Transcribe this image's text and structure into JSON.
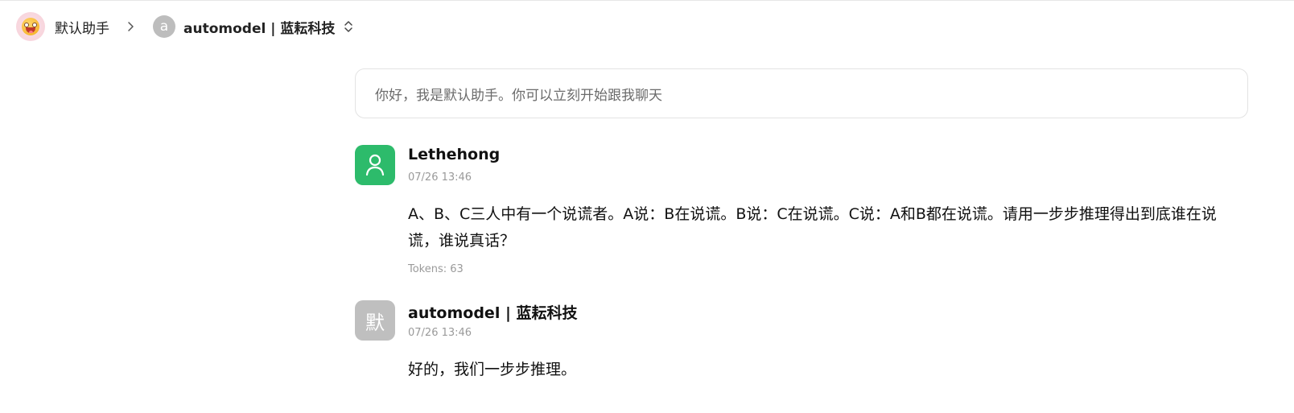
{
  "header": {
    "assistant_name": "默认助手",
    "model_initial": "a",
    "model_name": "automodel | 蓝耘科技"
  },
  "welcome": {
    "text": "你好，我是默认助手。你可以立刻开始跟我聊天"
  },
  "messages": [
    {
      "role": "user",
      "name": "Lethehong",
      "time": "07/26 13:46",
      "content": "A、B、C三人中有一个说谎者。A说：B在说谎。B说：C在说谎。C说：A和B都在说谎。请用一步步推理得出到底谁在说谎，谁说真话？",
      "tokens": "Tokens: 63",
      "avatar_icon": "user-icon",
      "avatar_color": "#2dbb6b"
    },
    {
      "role": "assistant",
      "name": "automodel | 蓝耘科技",
      "time": "07/26 13:46",
      "content": "好的，我们一步步推理。",
      "avatar_text": "默",
      "avatar_color": "#bfbfbf"
    }
  ],
  "colors": {
    "accent_green": "#2dbb6b",
    "muted_text": "#9a9a9a",
    "border": "#e3e3e3"
  }
}
